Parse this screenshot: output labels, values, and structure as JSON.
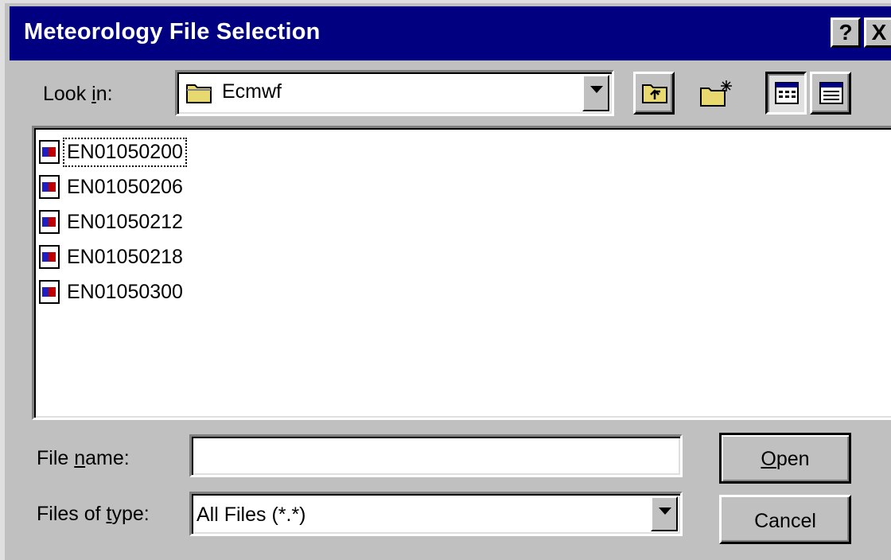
{
  "window": {
    "title": "Meteorology File Selection",
    "help_button": "?",
    "close_button": "X"
  },
  "look_in": {
    "label_pre": "Look ",
    "label_accel": "i",
    "label_post": "n:",
    "value": "Ecmwf"
  },
  "toolbar": {
    "icons": [
      "up-one-level-icon",
      "create-new-folder-icon",
      "list-view-icon",
      "details-view-icon"
    ]
  },
  "files": [
    {
      "name": "EN01050200",
      "focused": true
    },
    {
      "name": "EN01050206"
    },
    {
      "name": "EN01050212"
    },
    {
      "name": "EN01050218"
    },
    {
      "name": "EN01050300"
    }
  ],
  "file_name": {
    "label_pre": "File ",
    "label_accel": "n",
    "label_post": "ame:",
    "value": ""
  },
  "file_type": {
    "label_pre": "Files of ",
    "label_accel": "t",
    "label_post": "ype:",
    "value": "All Files (*.*)"
  },
  "buttons": {
    "open_accel": "O",
    "open_rest": "pen",
    "cancel": "Cancel"
  },
  "colors": {
    "titlebar": "#000080",
    "face": "#c0c0c0",
    "desktop": "#008080"
  }
}
